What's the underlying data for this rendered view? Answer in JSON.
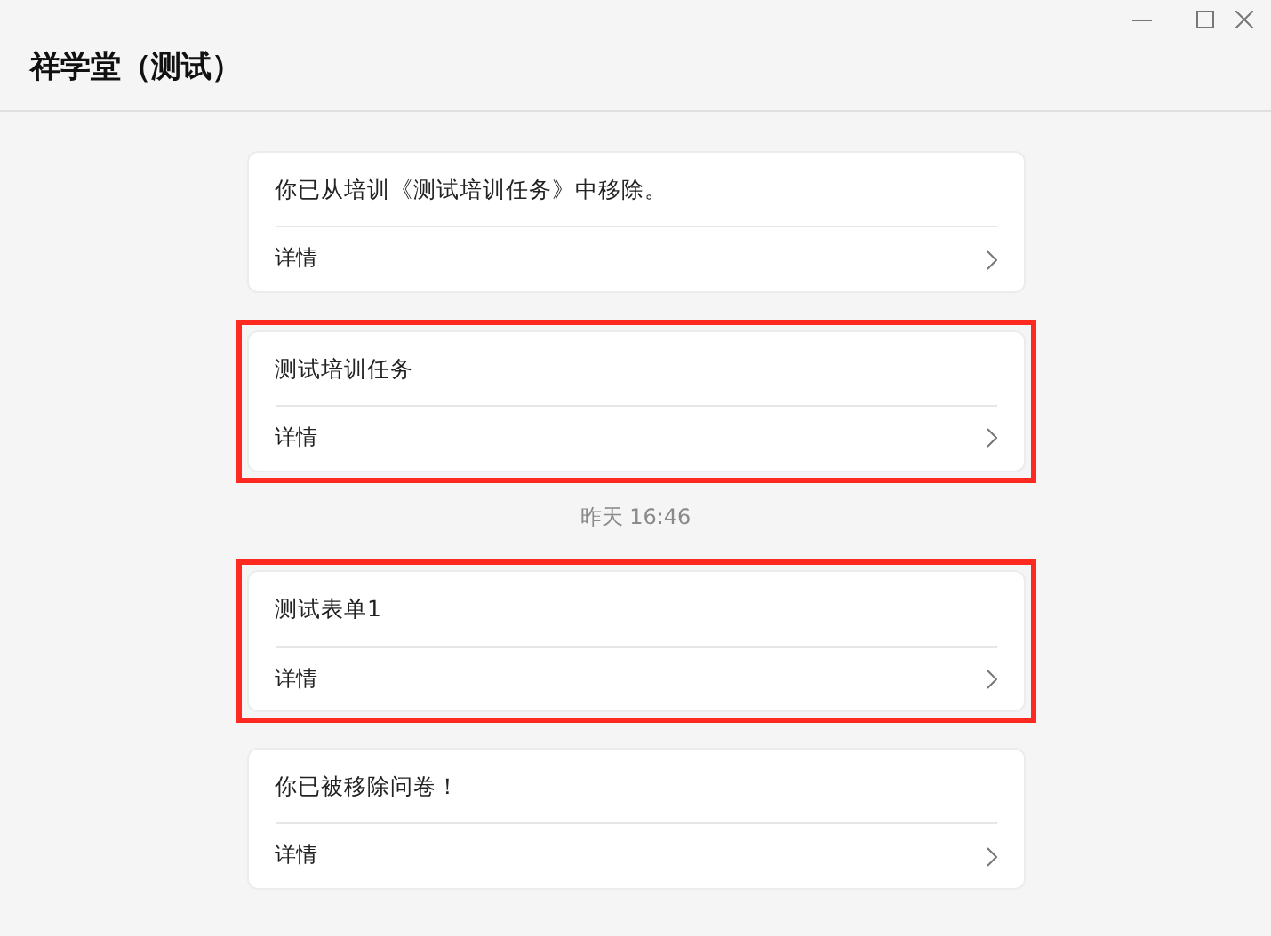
{
  "window": {
    "title": "祥学堂（测试）"
  },
  "messages": [
    {
      "kind": "card",
      "text": "你已从培训《测试培训任务》中移除。",
      "link": "详情",
      "highlighted": false
    },
    {
      "kind": "card",
      "text": "测试培训任务",
      "link": "详情",
      "highlighted": true
    },
    {
      "kind": "time",
      "text": "昨天 16:46"
    },
    {
      "kind": "card",
      "text": "测试表单1",
      "link": "详情",
      "highlighted": true
    },
    {
      "kind": "card",
      "text": "你已被移除问卷！",
      "link": "详情",
      "highlighted": false
    }
  ]
}
